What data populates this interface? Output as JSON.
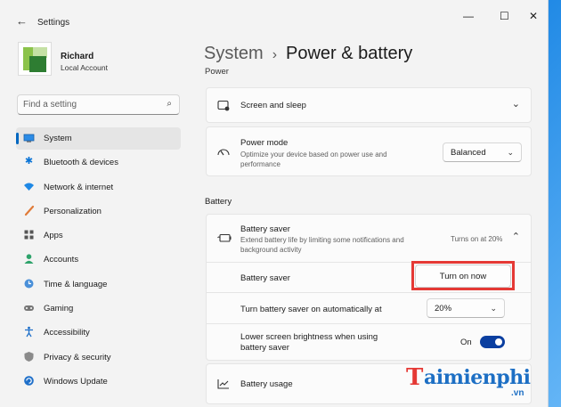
{
  "window": {
    "title": "Settings",
    "back_glyph": "←",
    "minimize_glyph": "—",
    "maximize_glyph": "☐",
    "close_glyph": "✕"
  },
  "profile": {
    "name": "Richard",
    "account_type": "Local Account"
  },
  "search": {
    "placeholder": "Find a setting",
    "icon": "search-icon"
  },
  "sidebar": {
    "items": [
      {
        "label": "System",
        "icon": "system-icon",
        "active": true
      },
      {
        "label": "Bluetooth & devices",
        "icon": "bluetooth-icon"
      },
      {
        "label": "Network & internet",
        "icon": "wifi-icon"
      },
      {
        "label": "Personalization",
        "icon": "brush-icon"
      },
      {
        "label": "Apps",
        "icon": "apps-icon"
      },
      {
        "label": "Accounts",
        "icon": "person-icon"
      },
      {
        "label": "Time & language",
        "icon": "globe-clock-icon"
      },
      {
        "label": "Gaming",
        "icon": "gamepad-icon"
      },
      {
        "label": "Accessibility",
        "icon": "accessibility-icon"
      },
      {
        "label": "Privacy & security",
        "icon": "shield-icon"
      },
      {
        "label": "Windows Update",
        "icon": "update-icon"
      }
    ]
  },
  "header": {
    "crumb": "System",
    "separator": "›",
    "title": "Power & battery"
  },
  "power": {
    "partial_heading": "Power",
    "screen_sleep": {
      "title": "Screen and sleep",
      "icon": "screen-sleep-icon"
    },
    "power_mode": {
      "title": "Power mode",
      "description": "Optimize your device based on power use and performance",
      "value": "Balanced",
      "icon": "power-mode-icon"
    }
  },
  "battery": {
    "heading": "Battery",
    "saver": {
      "title": "Battery saver",
      "description": "Extend battery life by limiting some notifications and background activity",
      "status": "Turns on at 20%",
      "icon": "battery-saver-icon"
    },
    "saver_row": {
      "label": "Battery saver",
      "button": "Turn on now"
    },
    "auto_row": {
      "label": "Turn battery saver on automatically at",
      "value": "20%"
    },
    "brightness_row": {
      "label": "Lower screen brightness when using battery saver",
      "toggle_label": "On",
      "toggle_on": true
    },
    "usage": {
      "title": "Battery usage",
      "icon": "chart-icon"
    }
  },
  "watermark": {
    "brand_initial": "T",
    "brand": "aimienphi",
    "tld": ".vn"
  },
  "colors": {
    "accent": "#0067c0",
    "highlight": "#e53935",
    "toggle": "#0b3fa0"
  }
}
